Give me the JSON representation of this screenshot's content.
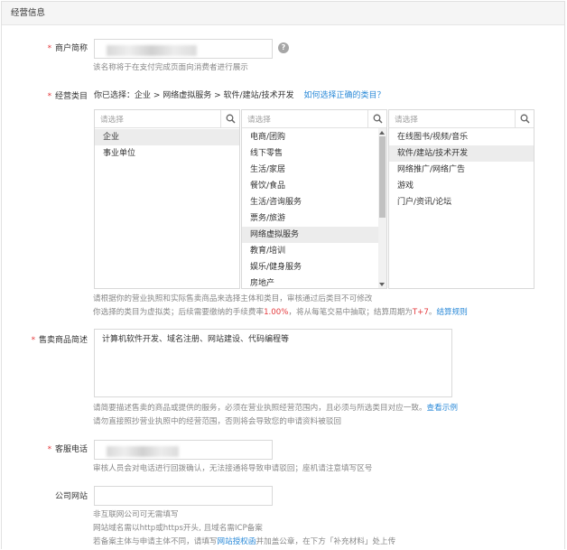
{
  "section": {
    "title": "经营信息"
  },
  "merchant_name": {
    "label": "商户简称",
    "hint": "该名称将于在支付完成页面向消费者进行展示"
  },
  "category": {
    "label": "经营类目",
    "selected_prefix": "你已选择：",
    "selected_path": "企业 > 网络虚拟服务 > 软件/建站/技术开发",
    "help_link": "如何选择正确的类目？",
    "search_placeholder": "请选择",
    "column1": [
      "企业",
      "事业单位"
    ],
    "column1_selected": 0,
    "column2": [
      "电商/团购",
      "线下零售",
      "生活/家居",
      "餐饮/食品",
      "生活/咨询服务",
      "票务/旅游",
      "网络虚拟服务",
      "教育/培训",
      "娱乐/健身服务",
      "房地产"
    ],
    "column2_selected": 6,
    "column3": [
      "在线图书/视频/音乐",
      "软件/建站/技术开发",
      "网络推广/网络广告",
      "游戏",
      "门户/资讯/论坛"
    ],
    "column3_selected": 1,
    "hint1": "请根据你的营业执照和实际售卖商品来选择主体和类目，审核通过后类目不可修改",
    "hint2_a": "你选择的类目为虚拟类；后续需要缴纳的手续费率",
    "fee_rate": "1.00%",
    "hint2_b": "，将从每笔交易中抽取；结算周期为",
    "settle_cycle": "T+7",
    "hint2_c": "。",
    "settle_link": "结算规则"
  },
  "product_desc": {
    "label": "售卖商品简述",
    "value": "计算机软件开发、域名注册、网站建设、代码编程等",
    "hint1": "请简要描述售卖的商品或提供的服务，必须在营业执照经营范围内，且必须与所选类目对应一致。",
    "example_link": "查看示例",
    "hint2": "请勿直接照抄营业执照中的经营范围，否则将会导致您的申请资料被驳回"
  },
  "phone": {
    "label": "客服电话",
    "hint": "审核人员会对电话进行回拨确认，无法接通将导致申请驳回；座机请注意填写区号"
  },
  "website": {
    "label": "公司网站",
    "hint1": "非互联网公司可无需填写",
    "hint2": "网站域名需以http或https开头, 且域名需ICP备案",
    "hint3_a": "若备案主体与申请主体不同，请填写",
    "auth_link": "网站授权函",
    "hint3_b": "并加盖公章，在下方「补充材料」处上传"
  },
  "icons": {
    "help": "question-circle-icon",
    "search": "magnifier-icon"
  }
}
